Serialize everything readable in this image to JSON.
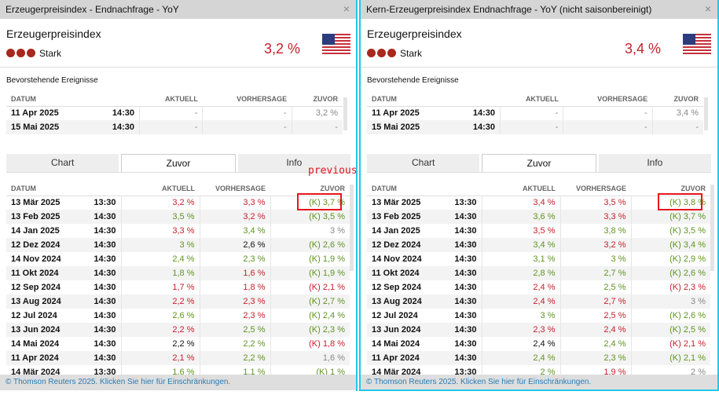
{
  "panels": [
    {
      "title": "Erzeugerpreisindex - Endnachfrage - YoY",
      "indicator": "Erzeugerpreisindex",
      "importance": "Stark",
      "value": "3,2 %",
      "upcoming_title": "Bevorstehende Ereignisse",
      "columns": [
        "DATUM",
        "AKTUELL",
        "VORHERSAGE",
        "ZUVOR"
      ],
      "upcoming": [
        [
          "11 Apr 2025",
          "14:30",
          "-",
          "-",
          "3,2 %"
        ],
        [
          "15 Mai 2025",
          "14:30",
          "-",
          "-",
          "-"
        ]
      ],
      "tabs": [
        "Chart",
        "Zuvor",
        "Info"
      ],
      "active_tab": "Zuvor",
      "history": [
        [
          "13 Mär 2025",
          "13:30",
          [
            "3,2 %",
            "red"
          ],
          [
            "3,3 %",
            "red"
          ],
          [
            "(K) 3,7 %",
            "green"
          ]
        ],
        [
          "13 Feb 2025",
          "14:30",
          [
            "3,5 %",
            "green"
          ],
          [
            "3,2 %",
            "red"
          ],
          [
            "(K) 3,5 %",
            "green"
          ]
        ],
        [
          "14 Jan 2025",
          "14:30",
          [
            "3,3 %",
            "red"
          ],
          [
            "3,4 %",
            "green"
          ],
          [
            "3 %",
            "gray"
          ]
        ],
        [
          "12 Dez 2024",
          "14:30",
          [
            "3 %",
            "green"
          ],
          [
            "2,6 %",
            "black"
          ],
          [
            "(K) 2,6 %",
            "green"
          ]
        ],
        [
          "14 Nov 2024",
          "14:30",
          [
            "2,4 %",
            "green"
          ],
          [
            "2,3 %",
            "green"
          ],
          [
            "(K) 1,9 %",
            "green"
          ]
        ],
        [
          "11 Okt 2024",
          "14:30",
          [
            "1,8 %",
            "green"
          ],
          [
            "1,6 %",
            "red"
          ],
          [
            "(K) 1,9 %",
            "green"
          ]
        ],
        [
          "12 Sep 2024",
          "14:30",
          [
            "1,7 %",
            "red"
          ],
          [
            "1,8 %",
            "red"
          ],
          [
            "(K) 2,1 %",
            "red"
          ]
        ],
        [
          "13 Aug 2024",
          "14:30",
          [
            "2,2 %",
            "red"
          ],
          [
            "2,3 %",
            "red"
          ],
          [
            "(K) 2,7 %",
            "green"
          ]
        ],
        [
          "12 Jul 2024",
          "14:30",
          [
            "2,6 %",
            "green"
          ],
          [
            "2,3 %",
            "red"
          ],
          [
            "(K) 2,4 %",
            "green"
          ]
        ],
        [
          "13 Jun 2024",
          "14:30",
          [
            "2,2 %",
            "red"
          ],
          [
            "2,5 %",
            "green"
          ],
          [
            "(K) 2,3 %",
            "green"
          ]
        ],
        [
          "14 Mai 2024",
          "14:30",
          [
            "2,2 %",
            "black"
          ],
          [
            "2,2 %",
            "green"
          ],
          [
            "(K) 1,8 %",
            "red"
          ]
        ],
        [
          "11 Apr 2024",
          "14:30",
          [
            "2,1 %",
            "red"
          ],
          [
            "2,2 %",
            "green"
          ],
          [
            "1,6 %",
            "gray"
          ]
        ],
        [
          "14 Mär 2024",
          "13:30",
          [
            "1,6 %",
            "green"
          ],
          [
            "1,1 %",
            "green"
          ],
          [
            "(K) 1 %",
            "green"
          ]
        ]
      ],
      "footer": "© Thomson Reuters 2025. Klicken Sie hier für Einschränkungen.",
      "annotation": "previous."
    },
    {
      "title": "Kern-Erzeugerpreisindex Endnachfrage - YoY (nicht saisonbereinigt)",
      "indicator": "Erzeugerpreisindex",
      "importance": "Stark",
      "value": "3,4 %",
      "upcoming_title": "Bevorstehende Ereignisse",
      "columns": [
        "DATUM",
        "AKTUELL",
        "VORHERSAGE",
        "ZUVOR"
      ],
      "upcoming": [
        [
          "11 Apr 2025",
          "14:30",
          "-",
          "-",
          "3,4 %"
        ],
        [
          "15 Mai 2025",
          "14:30",
          "-",
          "-",
          "-"
        ]
      ],
      "tabs": [
        "Chart",
        "Zuvor",
        "Info"
      ],
      "active_tab": "Zuvor",
      "history": [
        [
          "13 Mär 2025",
          "13:30",
          [
            "3,4 %",
            "red"
          ],
          [
            "3,5 %",
            "red"
          ],
          [
            "(K) 3,8 %",
            "green"
          ]
        ],
        [
          "13 Feb 2025",
          "14:30",
          [
            "3,6 %",
            "green"
          ],
          [
            "3,3 %",
            "red"
          ],
          [
            "(K) 3,7 %",
            "green"
          ]
        ],
        [
          "14 Jan 2025",
          "14:30",
          [
            "3,5 %",
            "red"
          ],
          [
            "3,8 %",
            "green"
          ],
          [
            "(K) 3,5 %",
            "green"
          ]
        ],
        [
          "12 Dez 2024",
          "14:30",
          [
            "3,4 %",
            "green"
          ],
          [
            "3,2 %",
            "red"
          ],
          [
            "(K) 3,4 %",
            "green"
          ]
        ],
        [
          "14 Nov 2024",
          "14:30",
          [
            "3,1 %",
            "green"
          ],
          [
            "3 %",
            "green"
          ],
          [
            "(K) 2,9 %",
            "green"
          ]
        ],
        [
          "11 Okt 2024",
          "14:30",
          [
            "2,8 %",
            "green"
          ],
          [
            "2,7 %",
            "green"
          ],
          [
            "(K) 2,6 %",
            "green"
          ]
        ],
        [
          "12 Sep 2024",
          "14:30",
          [
            "2,4 %",
            "red"
          ],
          [
            "2,5 %",
            "green"
          ],
          [
            "(K) 2,3 %",
            "red"
          ]
        ],
        [
          "13 Aug 2024",
          "14:30",
          [
            "2,4 %",
            "red"
          ],
          [
            "2,7 %",
            "red"
          ],
          [
            "3 %",
            "gray"
          ]
        ],
        [
          "12 Jul 2024",
          "14:30",
          [
            "3 %",
            "green"
          ],
          [
            "2,5 %",
            "red"
          ],
          [
            "(K) 2,6 %",
            "green"
          ]
        ],
        [
          "13 Jun 2024",
          "14:30",
          [
            "2,3 %",
            "red"
          ],
          [
            "2,4 %",
            "red"
          ],
          [
            "(K) 2,5 %",
            "green"
          ]
        ],
        [
          "14 Mai 2024",
          "14:30",
          [
            "2,4 %",
            "black"
          ],
          [
            "2,4 %",
            "green"
          ],
          [
            "(K) 2,1 %",
            "red"
          ]
        ],
        [
          "11 Apr 2024",
          "14:30",
          [
            "2,4 %",
            "green"
          ],
          [
            "2,3 %",
            "green"
          ],
          [
            "(K) 2,1 %",
            "green"
          ]
        ],
        [
          "14 Mär 2024",
          "13:30",
          [
            "2 %",
            "green"
          ],
          [
            "1,9 %",
            "red"
          ],
          [
            "2 %",
            "gray"
          ]
        ]
      ],
      "footer": "© Thomson Reuters 2025. Klicken Sie hier für Einschränkungen."
    }
  ],
  "colors": {
    "red": "#c8202c",
    "green": "#5f9420",
    "accent": "#20c8e8"
  }
}
